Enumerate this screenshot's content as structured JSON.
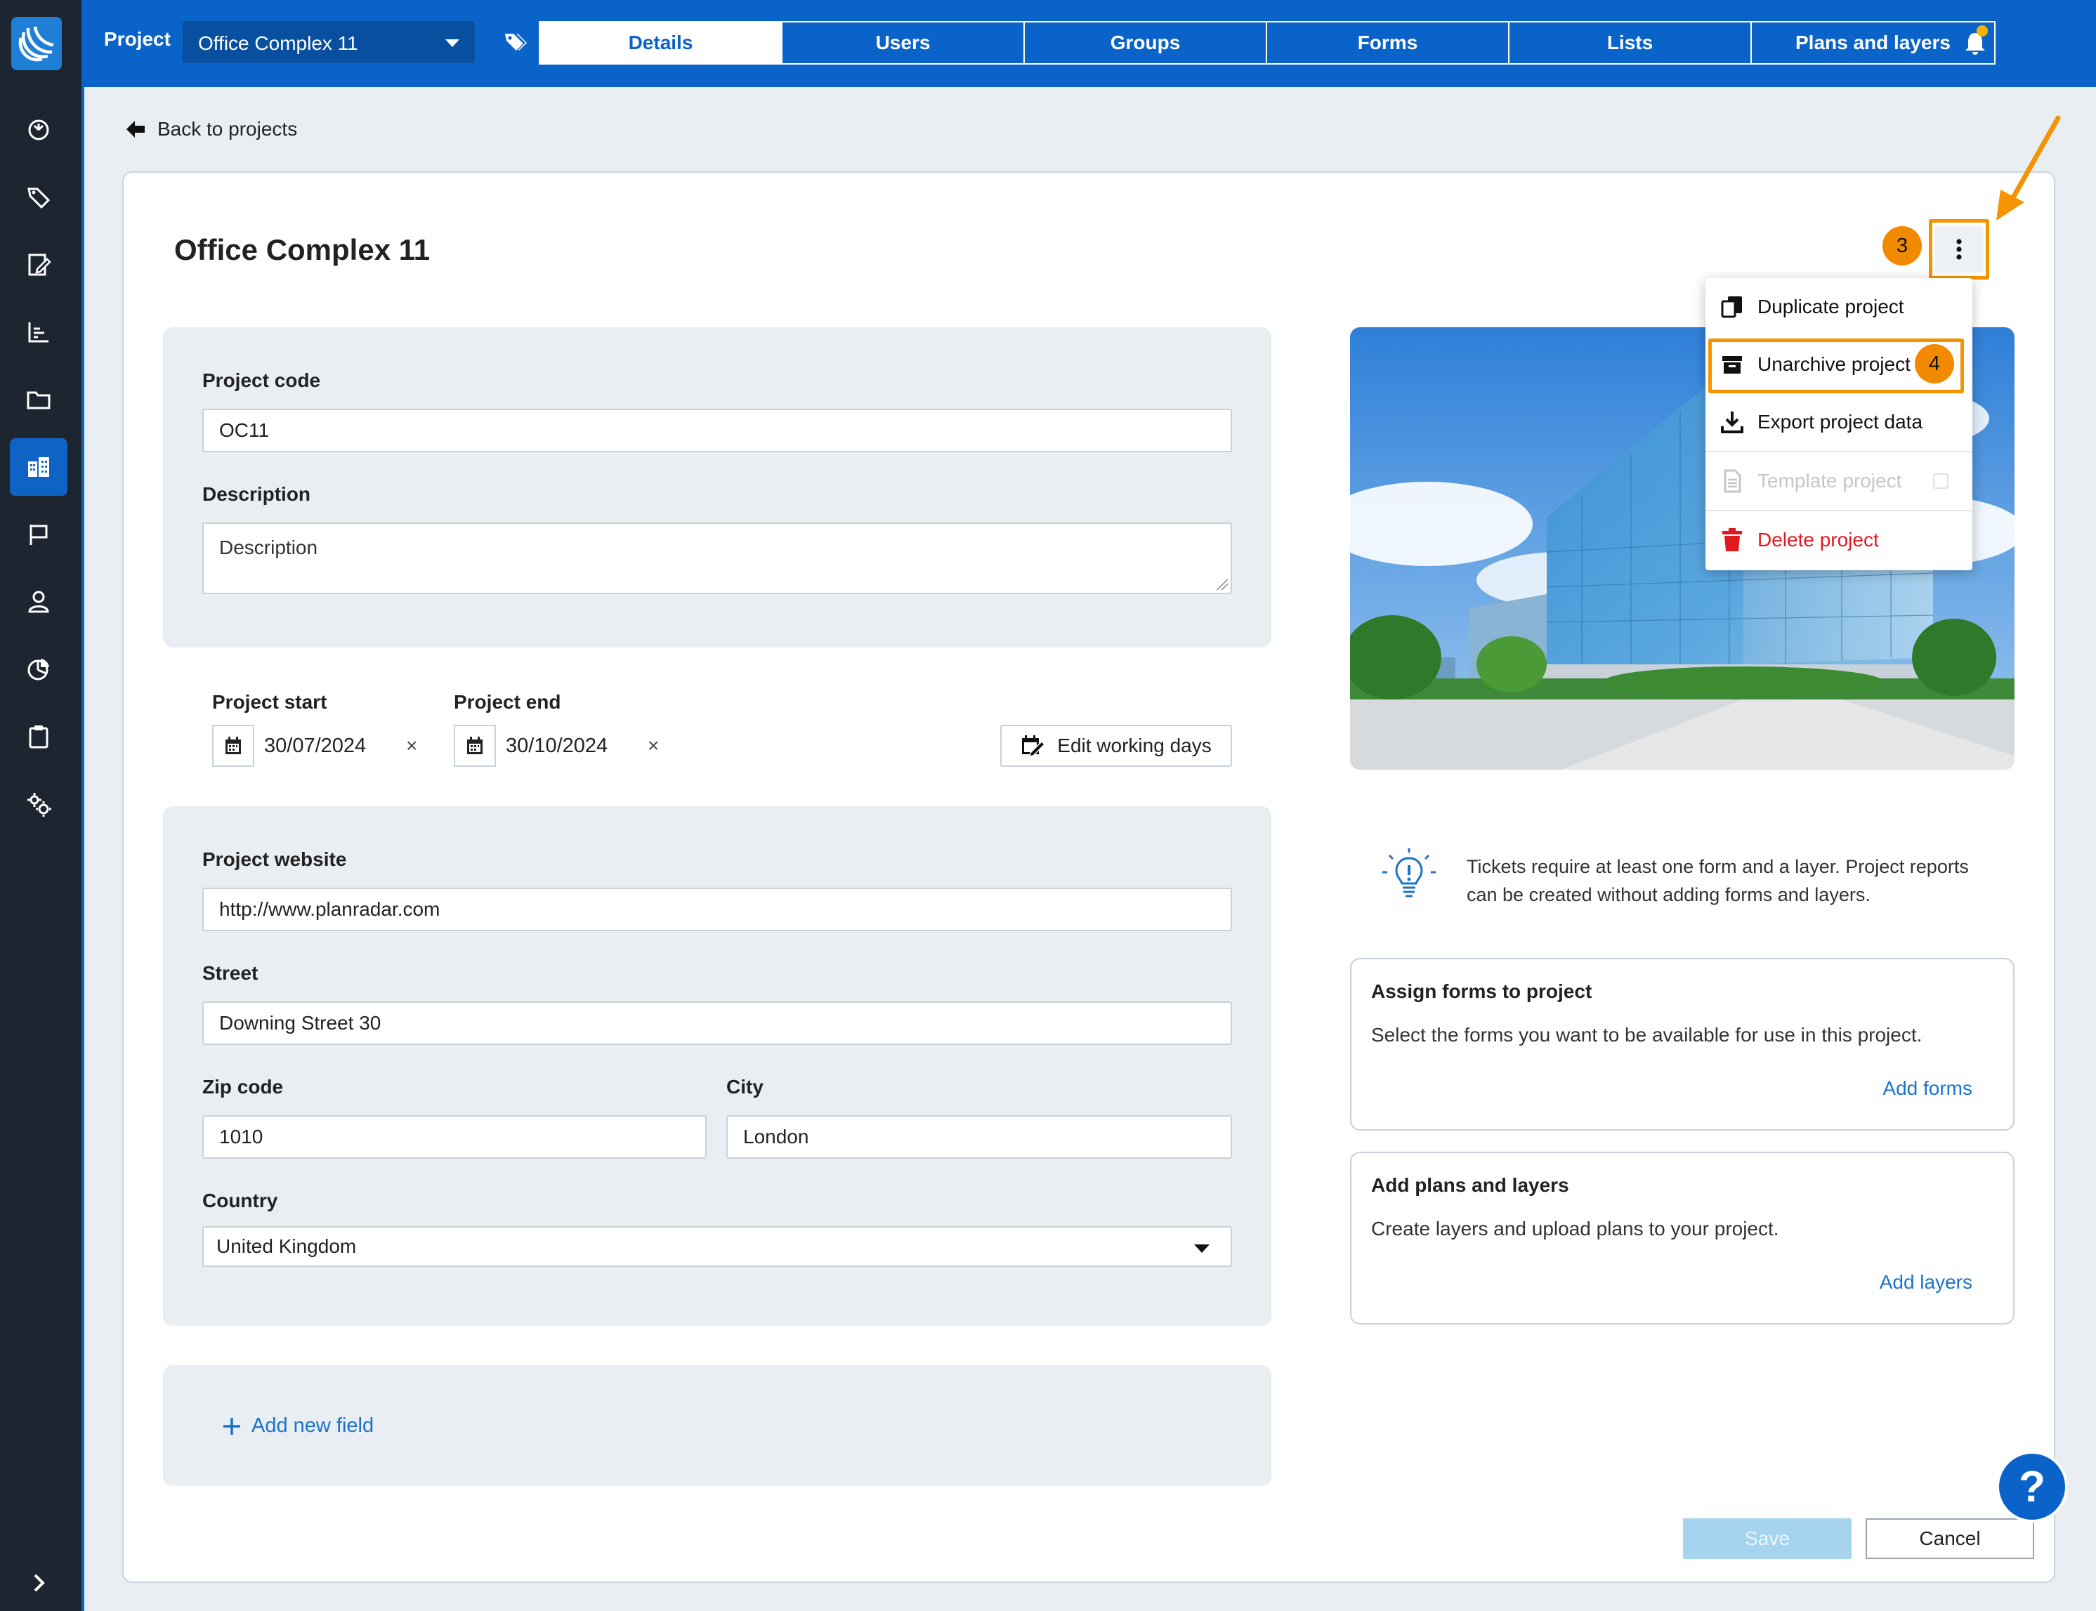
{
  "topbar": {
    "project_label": "Project",
    "project_selected": "Office Complex 11",
    "tabs": [
      {
        "label": "Details",
        "active": true
      },
      {
        "label": "Users",
        "active": false
      },
      {
        "label": "Groups",
        "active": false
      },
      {
        "label": "Forms",
        "active": false
      },
      {
        "label": "Lists",
        "active": false
      },
      {
        "label": "Plans and layers",
        "active": false
      }
    ],
    "notification_dot_color": "#f5b400"
  },
  "sidebar": {
    "items": [
      {
        "icon": "dashboard-icon"
      },
      {
        "icon": "tag-icon"
      },
      {
        "icon": "edit-form-icon"
      },
      {
        "icon": "chart-icon"
      },
      {
        "icon": "folder-icon"
      },
      {
        "icon": "buildings-icon",
        "active": true
      },
      {
        "icon": "flag-icon"
      },
      {
        "icon": "user-icon"
      },
      {
        "icon": "pie-chart-icon"
      },
      {
        "icon": "clipboard-icon"
      },
      {
        "icon": "settings-icon"
      }
    ]
  },
  "main": {
    "back_label": "Back to projects",
    "title": "Office Complex 11",
    "project_code": {
      "label": "Project code",
      "value": "OC11"
    },
    "description": {
      "label": "Description",
      "placeholder": "Description"
    },
    "project_start": {
      "label": "Project start",
      "value": "30/07/2024"
    },
    "project_end": {
      "label": "Project end",
      "value": "30/10/2024"
    },
    "clear_symbol": "×",
    "edit_working_days": "Edit working days",
    "website": {
      "label": "Project website",
      "value": "http://www.planradar.com"
    },
    "street": {
      "label": "Street",
      "value": "Downing Street 30"
    },
    "zip": {
      "label": "Zip code",
      "value": "1010"
    },
    "city": {
      "label": "City",
      "value": "London"
    },
    "country": {
      "label": "Country",
      "value": "United Kingdom"
    },
    "add_field": "Add new field",
    "save": "Save",
    "cancel": "Cancel"
  },
  "right": {
    "info_text": "Tickets require at least one form and a layer. Project reports can be created without adding forms and layers.",
    "forms_card": {
      "title": "Assign forms to project",
      "text": "Select the forms you want to be available for use in this project.",
      "link": "Add forms"
    },
    "layers_card": {
      "title": "Add plans and layers",
      "text": "Create layers and upload plans to your project.",
      "link": "Add layers"
    }
  },
  "menu": {
    "items": [
      {
        "label": "Duplicate project",
        "icon": "duplicate-icon"
      },
      {
        "label": "Unarchive project",
        "icon": "archive-box-icon"
      },
      {
        "label": "Export project data",
        "icon": "download-icon"
      },
      {
        "label": "Template project",
        "icon": "document-icon",
        "disabled": true
      },
      {
        "label": "Delete project",
        "icon": "trash-icon",
        "danger": true
      }
    ]
  },
  "annotations": {
    "step3": "3",
    "step4": "4",
    "highlight_color": "#f59300"
  },
  "help": "?"
}
